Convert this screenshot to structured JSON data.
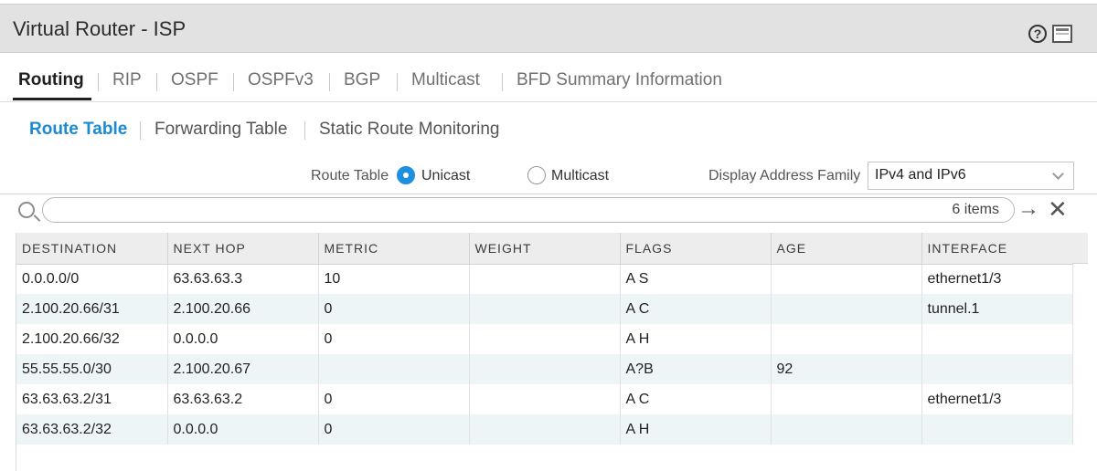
{
  "window": {
    "title": "Virtual Router - ISP"
  },
  "icons": {
    "help": "help-icon",
    "maximize": "maximize-icon",
    "search": "search-icon",
    "go": "arrow-right-icon",
    "clear": "close-icon"
  },
  "tabs": [
    {
      "label": "Routing",
      "active": true
    },
    {
      "label": "RIP"
    },
    {
      "label": "OSPF"
    },
    {
      "label": "OSPFv3"
    },
    {
      "label": "BGP"
    },
    {
      "label": "Multicast"
    },
    {
      "label": "BFD Summary Information"
    }
  ],
  "subtabs": [
    {
      "label": "Route Table",
      "active": true
    },
    {
      "label": "Forwarding Table"
    },
    {
      "label": "Static Route Monitoring"
    }
  ],
  "options": {
    "route_table_label": "Route Table",
    "unicast_label": "Unicast",
    "multicast_label": "Multicast",
    "selected": "Unicast",
    "address_family_label": "Display Address Family",
    "address_family_value": "IPv4 and IPv6"
  },
  "search": {
    "value": "",
    "items_count": "6 items"
  },
  "table": {
    "columns": [
      "DESTINATION",
      "NEXT HOP",
      "METRIC",
      "WEIGHT",
      "FLAGS",
      "AGE",
      "INTERFACE"
    ],
    "rows": [
      [
        "0.0.0.0/0",
        "63.63.63.3",
        "10",
        "",
        "A S",
        "",
        "ethernet1/3"
      ],
      [
        "2.100.20.66/31",
        "2.100.20.66",
        "0",
        "",
        "A C",
        "",
        "tunnel.1"
      ],
      [
        "2.100.20.66/32",
        "0.0.0.0",
        "0",
        "",
        "A H",
        "",
        ""
      ],
      [
        "55.55.55.0/30",
        "2.100.20.67",
        "",
        "",
        "A?B",
        "92",
        ""
      ],
      [
        "63.63.63.2/31",
        "63.63.63.2",
        "0",
        "",
        "A C",
        "",
        "ethernet1/3"
      ],
      [
        "63.63.63.2/32",
        "0.0.0.0",
        "0",
        "",
        "A H",
        "",
        ""
      ]
    ]
  },
  "colors": {
    "accent": "#1a8bd3",
    "radio_selected": "#1f8fe0",
    "header_bg": "#e2e2e2",
    "row_alt": "#eef5f7"
  }
}
